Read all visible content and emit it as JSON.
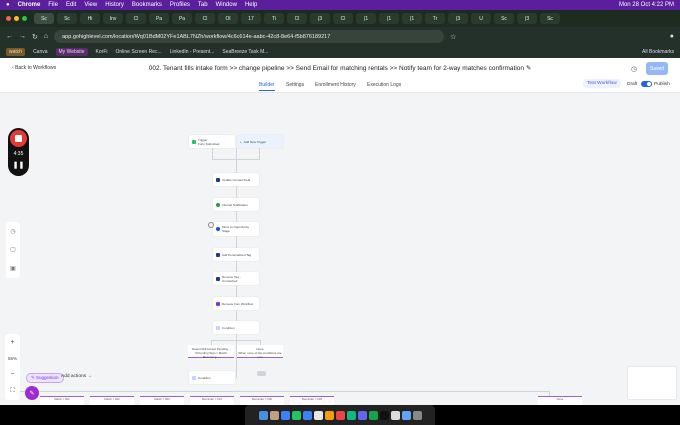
{
  "menubar": {
    "apple": "",
    "app": "Chrome",
    "items": [
      "File",
      "Edit",
      "View",
      "History",
      "Bookmarks",
      "Profiles",
      "Tab",
      "Window",
      "Help"
    ],
    "datetime": "Mon 28 Oct 4:22 PM"
  },
  "tabs": [
    "Sc",
    "Sc",
    "Hi",
    "Inv",
    "Cl",
    "Pa",
    "Pa",
    "Cl",
    "Ol",
    "17",
    "Ti",
    "Cl",
    "(3",
    "Cl",
    "(1",
    "(1",
    "(1",
    "Tr",
    "(3",
    "U",
    "Sc",
    "(3",
    "Sc"
  ],
  "browser": {
    "url": "app.gohighlevel.com/location/Wq01BdM02YFe1ABL7NZh/workflow/4c6c614e-aabc-42c8-8e64-f5b876189217",
    "all_bookmarks": "All Bookmarks"
  },
  "bookmarks": [
    "watch",
    "Canva",
    "My Website",
    "KorFi",
    "Online Screen Rec...",
    "LinkedIn - Present...",
    "SeaBreeze Task M..."
  ],
  "header": {
    "back": "Back to Workflows",
    "title": "002. Tenant fills intake form >> change pipeline >> Send Email for matching rentals >> Notify team for 2-way matches confirmation",
    "saved": "Saved",
    "tabs": [
      "Builder",
      "Settings",
      "Enrollment History",
      "Execution Logs"
    ],
    "test": "Test Workflow",
    "draft": "Draft",
    "publish": "Publish"
  },
  "recorder": {
    "time": "4:35"
  },
  "zoom": {
    "plus": "+",
    "value": "55%",
    "minus": "−"
  },
  "suggestions": "Suggestion",
  "add_actions": "Add actions →",
  "nodes": {
    "trigger": "Trigger",
    "trigger_sub": "Form Submitted",
    "add_trigger": "Add New Trigger",
    "steps": [
      "Update Contact Field",
      "Internal Notification",
      "Move to Opportunity Stage",
      "Add Personalized Tag",
      "Remove Tag - Unmatched",
      "Remove from Workflow",
      "Condition"
    ],
    "branch_left": "Tenant Will Accept Pending...",
    "branch_left_sub": "If Pending Sign = Match Becoming...",
    "branch_right": "None",
    "branch_right_sub": "When none of the conditions are met",
    "condition2": "Condition",
    "bottom": [
      "Match = 001",
      "Match = 002",
      "Match = 003",
      "Reminder = 001",
      "Reminder = 002",
      "Reminder = 003",
      "None"
    ]
  },
  "colors": {
    "menubar": "#5b1f9e",
    "accent": "#2563eb",
    "branch": "#9b5de5"
  }
}
